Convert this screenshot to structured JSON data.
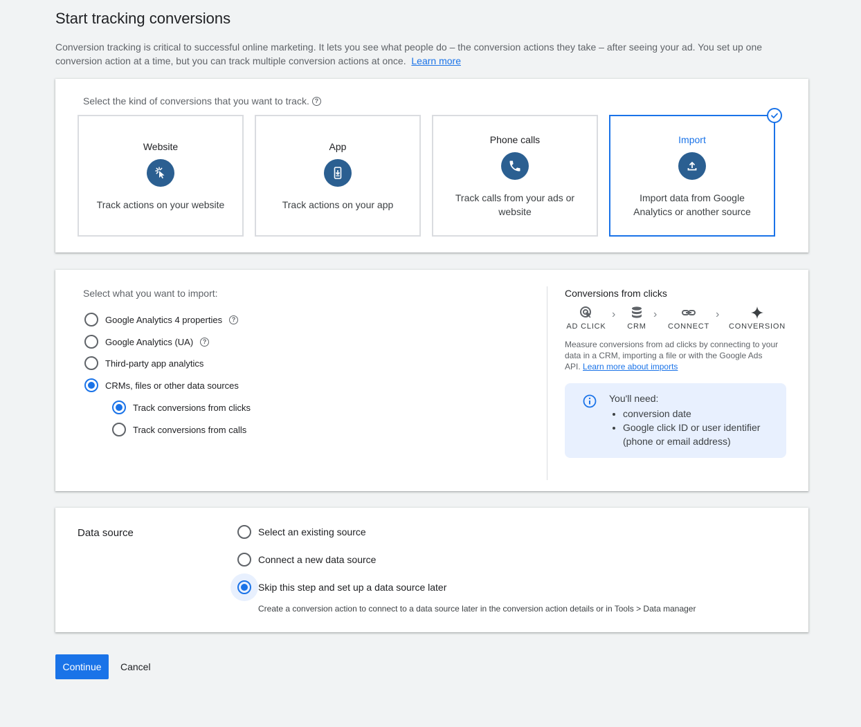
{
  "header": {
    "title": "Start tracking conversions",
    "intro": "Conversion tracking is critical to successful online marketing. It lets you see what people do – the conversion actions they take – after seeing your ad. You set up one conversion action at a time, but you can track multiple conversion actions at once.",
    "learn_more": "Learn more"
  },
  "kind": {
    "question": "Select the kind of conversions that you want to track.",
    "tiles": [
      {
        "title": "Website",
        "desc": "Track actions on your website",
        "icon": "cursor-click-icon"
      },
      {
        "title": "App",
        "desc": "Track actions on your app",
        "icon": "phone-download-icon"
      },
      {
        "title": "Phone calls",
        "desc": "Track calls from your ads or website",
        "icon": "phone-icon"
      },
      {
        "title": "Import",
        "desc": "Import data from Google Analytics or another source",
        "icon": "upload-icon",
        "selected": true
      }
    ]
  },
  "import": {
    "question": "Select what you want to import:",
    "options": [
      {
        "label": "Google Analytics 4 properties",
        "checked": false
      },
      {
        "label": "Google Analytics (UA)",
        "checked": false
      },
      {
        "label": "Third-party app analytics",
        "checked": false
      },
      {
        "label": "CRMs, files or other data sources",
        "checked": true
      }
    ],
    "sub_options": [
      {
        "label": "Track conversions from clicks",
        "checked": true
      },
      {
        "label": "Track conversions from calls",
        "checked": false
      }
    ],
    "side": {
      "title": "Conversions from clicks",
      "steps": [
        "AD CLICK",
        "CRM",
        "CONNECT",
        "CONVERSION"
      ],
      "desc": "Measure conversions from ad clicks by connecting to your data in a CRM, importing a file or with the Google Ads API.",
      "learn_more": "Learn more about imports",
      "need_title": "You'll need:",
      "need_items": [
        "conversion date",
        "Google click ID or user identifier (phone or email address)"
      ]
    }
  },
  "data_source": {
    "label": "Data source",
    "options": [
      {
        "label": "Select an existing source",
        "checked": false
      },
      {
        "label": "Connect a new data source",
        "checked": false
      },
      {
        "label": "Skip this step and set up a data source later",
        "checked": true
      }
    ],
    "hint": "Create a conversion action to connect to a data source later in the conversion action details or in Tools > Data manager"
  },
  "footer": {
    "continue": "Continue",
    "cancel": "Cancel"
  },
  "colors": {
    "accent": "#1a73e8",
    "icon_bg": "#2b5f91",
    "info_bg": "#e8f0fe"
  }
}
